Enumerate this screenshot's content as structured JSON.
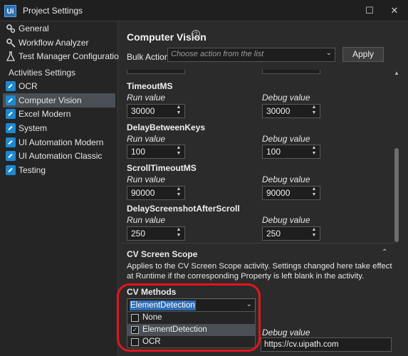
{
  "window": {
    "logo": "Ui",
    "title": "Project Settings",
    "maximize_icon": "maximize-icon",
    "close_icon": "close-icon"
  },
  "sidebar": {
    "top_items": [
      {
        "label": "General",
        "icon": "gears-icon"
      },
      {
        "label": "Workflow Analyzer",
        "icon": "analyzer-icon"
      },
      {
        "label": "Test Manager Configuration",
        "icon": "flask-icon"
      }
    ],
    "section": "Activities Settings",
    "activity_items": [
      {
        "label": "OCR",
        "icon": "activity-arrow-icon"
      },
      {
        "label": "Computer Vision",
        "icon": "activity-arrow-icon",
        "selected": true
      },
      {
        "label": "Excel Modern",
        "icon": "activity-arrow-icon"
      },
      {
        "label": "System",
        "icon": "activity-arrow-icon"
      },
      {
        "label": "UI Automation Modern",
        "icon": "activity-arrow-icon"
      },
      {
        "label": "UI Automation Classic",
        "icon": "activity-arrow-icon"
      },
      {
        "label": "Testing",
        "icon": "activity-arrow-icon"
      }
    ]
  },
  "main": {
    "title": "Computer Vision",
    "help_icon": "?",
    "bulk_action_label": "Bulk Action",
    "bulk_action_placeholder": "Choose action from the list",
    "apply_label": "Apply",
    "settings": [
      {
        "name": "TimeoutMS",
        "run_label": "Run value",
        "run_value": "30000",
        "debug_label": "Debug value",
        "debug_value": "30000"
      },
      {
        "name": "DelayBetweenKeys",
        "run_label": "Run value",
        "run_value": "100",
        "debug_label": "Debug value",
        "debug_value": "100"
      },
      {
        "name": "ScrollTimeoutMS",
        "run_label": "Run value",
        "run_value": "90000",
        "debug_label": "Debug value",
        "debug_value": "90000"
      },
      {
        "name": "DelayScreenshotAfterScroll",
        "run_label": "Run value",
        "run_value": "250",
        "debug_label": "Debug value",
        "debug_value": "250"
      }
    ],
    "scope": {
      "title": "CV Screen Scope",
      "description": "Applies to the CV Screen Scope activity. Settings changed here take effect at Runtime if the corresponding Property is left blank in the activity.",
      "methods_label": "CV Methods",
      "methods_selected": "ElementDetection",
      "methods_options": [
        {
          "label": "None",
          "checked": false
        },
        {
          "label": "ElementDetection",
          "checked": true
        },
        {
          "label": "OCR",
          "checked": false
        }
      ],
      "debug_label": "Debug value",
      "server_debug_value": "https://cv.uipath.com"
    }
  },
  "colors": {
    "accent": "#2f6db5",
    "activity_icon": "#1e88d0",
    "highlight_ring": "#e5141b",
    "selected_bg": "#4a4f55"
  }
}
